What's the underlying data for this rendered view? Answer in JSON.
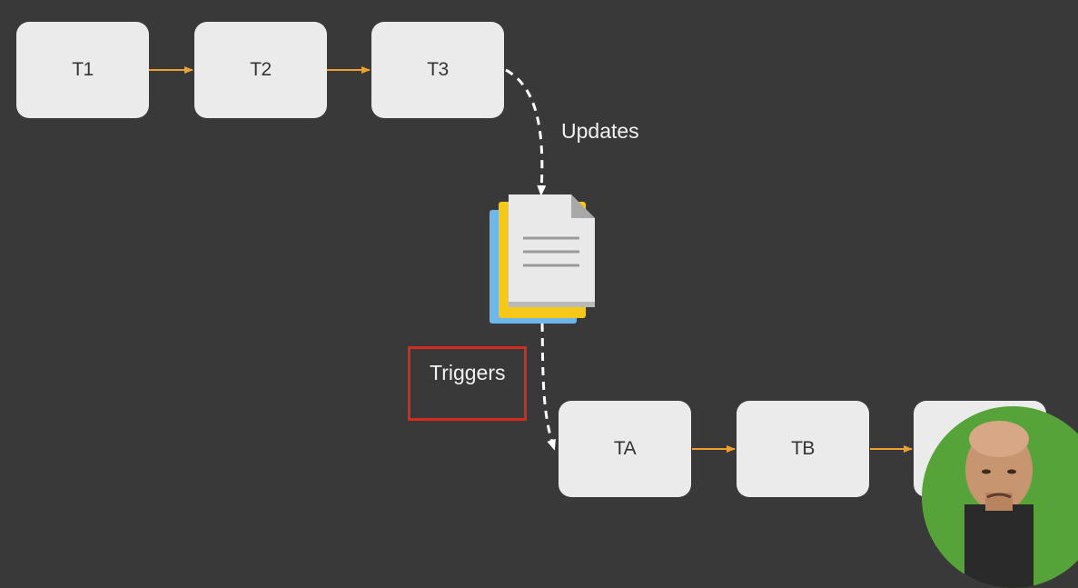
{
  "diagram": {
    "top_row": [
      {
        "label": "T1"
      },
      {
        "label": "T2"
      },
      {
        "label": "T3"
      }
    ],
    "bottom_row": [
      {
        "label": "TA"
      },
      {
        "label": "TB"
      },
      {
        "label": ""
      }
    ],
    "updates_label": "Updates",
    "triggers_label": "Triggers",
    "colors": {
      "background": "#393939",
      "box": "#ebebeb",
      "flow_arrow": "#f0a030",
      "dashed_arrow": "#ffffff",
      "highlight_border": "#d62a1e",
      "presenter_bg": "#56a33a"
    },
    "icons": [
      "document-stack-icon",
      "presenter-avatar"
    ]
  }
}
